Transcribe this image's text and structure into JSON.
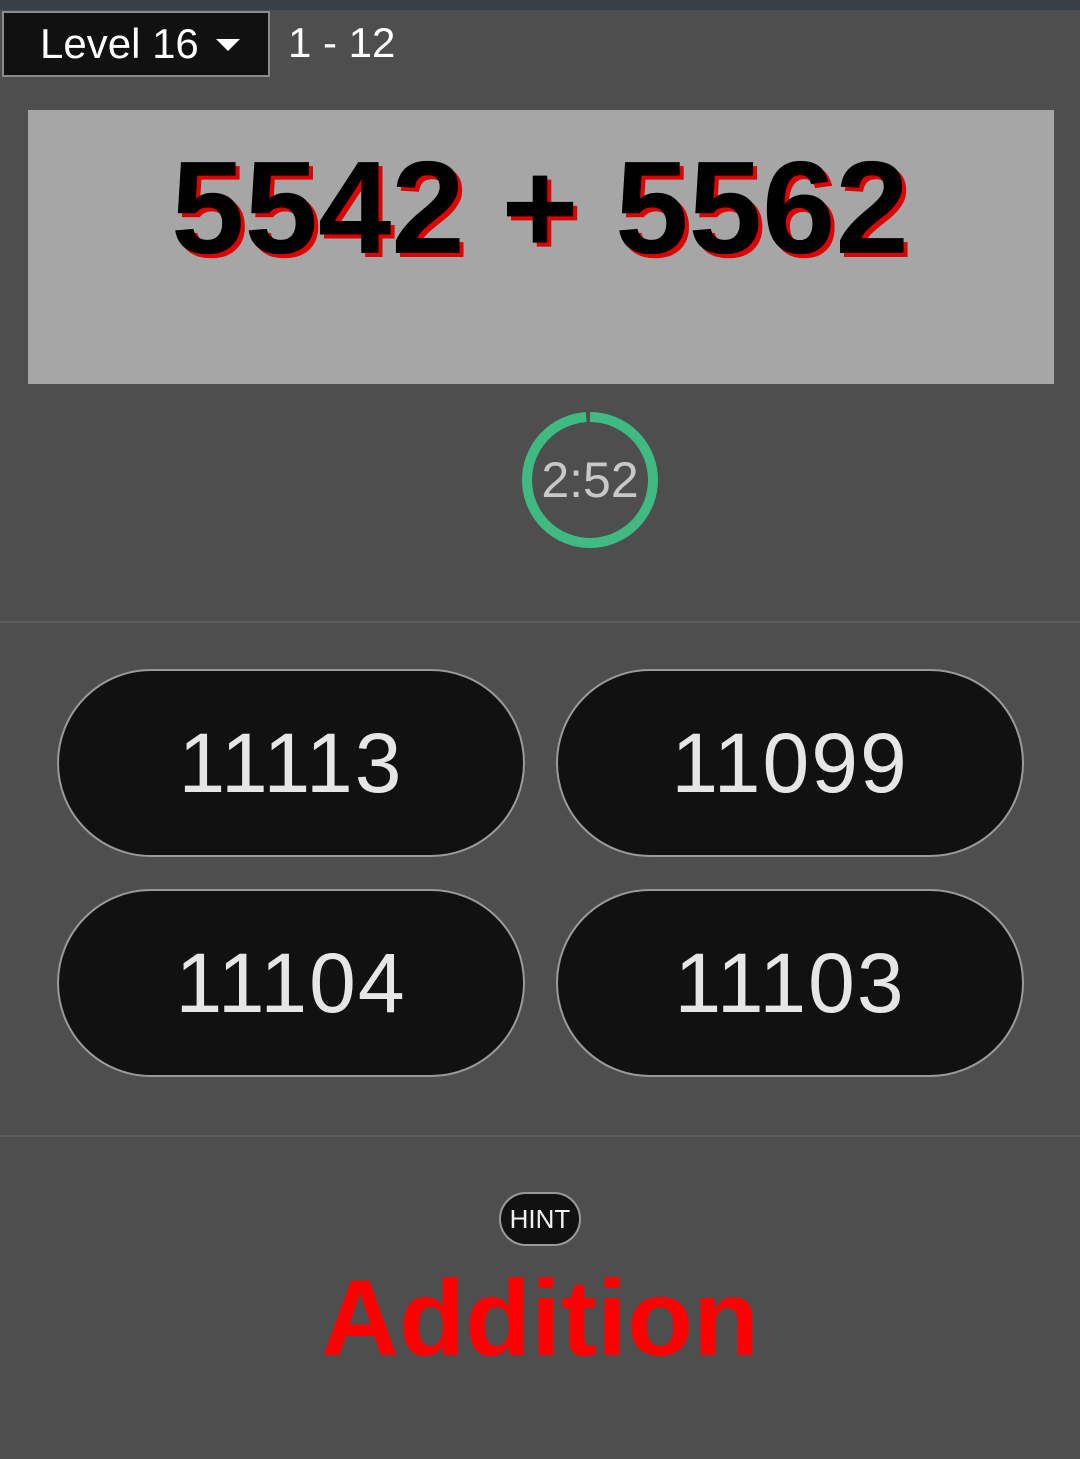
{
  "header": {
    "level_label": "Level 16",
    "range_text": "1 - 12"
  },
  "question": {
    "text": "5542 + 5562"
  },
  "timer": {
    "text": "2:52",
    "progress_fraction": 0.99,
    "ring_color": "#3fbb82"
  },
  "answers": [
    {
      "label": "11113"
    },
    {
      "label": "11099"
    },
    {
      "label": "11104"
    },
    {
      "label": "11103"
    }
  ],
  "hint": {
    "label": "HINT"
  },
  "operation": {
    "label": "Addition",
    "color": "#ff0000"
  }
}
